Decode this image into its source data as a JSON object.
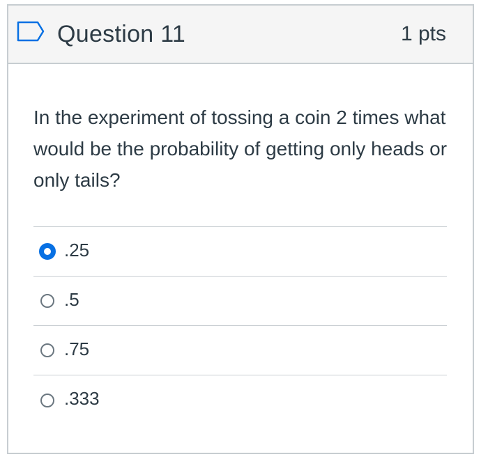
{
  "question": {
    "title": "Question 11",
    "points": "1 pts",
    "flag_icon": "flag-outline-icon",
    "text": "In the experiment of tossing a coin 2 times what would be the probability of getting only heads or only tails?"
  },
  "answers": [
    {
      "label": ".25",
      "selected": true
    },
    {
      "label": ".5",
      "selected": false
    },
    {
      "label": ".75",
      "selected": false
    },
    {
      "label": ".333",
      "selected": false
    }
  ],
  "colors": {
    "accent": "#0770e3",
    "text": "#2d3b45",
    "border": "#c7cdd1",
    "header_bg": "#f5f5f5"
  }
}
